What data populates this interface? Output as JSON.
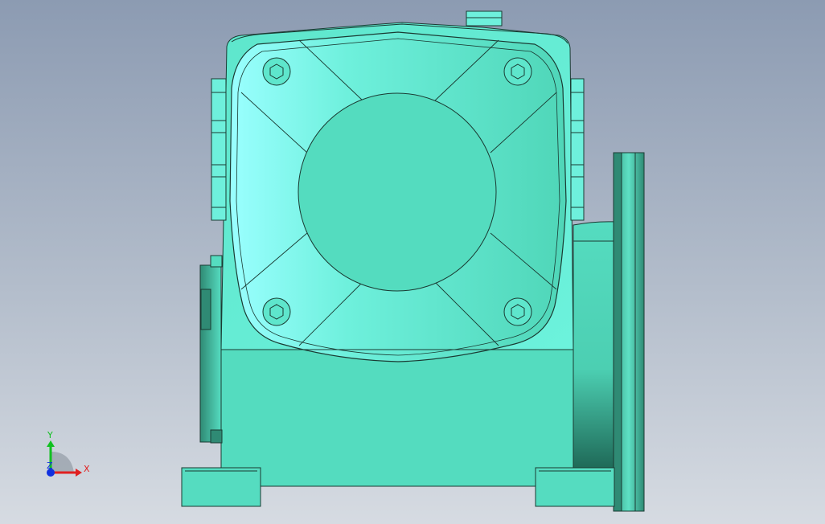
{
  "viewport": {
    "background_top": "#8c9bb2",
    "background_bottom": "#d6dbe2"
  },
  "model": {
    "body_color": "#55dcc0",
    "highlight_color": "#8ffff0",
    "shadow_color": "#2f8a74",
    "edge_color": "#1a3a32"
  },
  "triad": {
    "x_label": "X",
    "y_label": "Y",
    "z_label": "Z",
    "x_color": "#e02020",
    "y_color": "#10c020",
    "z_color": "#1030e0"
  }
}
